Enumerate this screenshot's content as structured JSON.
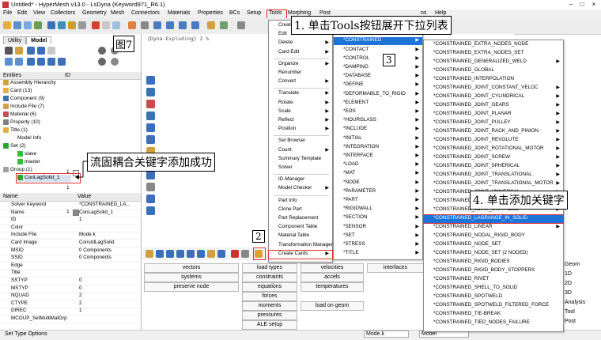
{
  "window": {
    "title": "Untitled* - HyperMesh v13.0 - LsDyna (Keyword971_R6.1)"
  },
  "menubar": [
    "File",
    "Edit",
    "View",
    "Collectors",
    "Geometry",
    "Mesh",
    "Connectors",
    "Materials",
    "Properties",
    "BCs",
    "Setup",
    "Tools",
    "Morphing",
    "Post",
    "ns",
    "Help"
  ],
  "command_line": "{Dyna-Exploding} 2 %",
  "browser": {
    "tabs": [
      "Utility",
      "Model"
    ],
    "columns": [
      "Entities",
      "ID"
    ],
    "tree": [
      {
        "label": "Assembly Hierarchy"
      },
      {
        "label": "Card (13)"
      },
      {
        "label": "Component (9)"
      },
      {
        "label": "Include File (7)"
      },
      {
        "label": "Material (6)"
      },
      {
        "label": "Property (10)"
      },
      {
        "label": "Title (1)"
      },
      {
        "label": "Model Info",
        "id": "1"
      },
      {
        "label": "Set (2)"
      },
      {
        "label": "slave",
        "id": "1"
      },
      {
        "label": "master",
        "id": "2"
      },
      {
        "label": "Group (1)"
      },
      {
        "label": "ConLagSolid_1",
        "id": "1"
      }
    ]
  },
  "properties": {
    "columns": [
      "Name",
      "Value"
    ],
    "rows": [
      {
        "k": "Solver Keyword",
        "v": "*CONSTRAINED_LA..."
      },
      {
        "k": "Name",
        "v": "ConLagSolid_1"
      },
      {
        "k": "ID",
        "v": "1"
      },
      {
        "k": "Color",
        "v": ""
      },
      {
        "k": "Include File",
        "v": "Mode.k"
      },
      {
        "k": "Card Image",
        "v": "ConstdLagSolid"
      },
      {
        "k": "MSID",
        "v": "0 Components"
      },
      {
        "k": "SSID",
        "v": "0 Components"
      },
      {
        "k": "Edge",
        "v": ""
      },
      {
        "k": "Title",
        "v": ""
      },
      {
        "k": "SSTYP",
        "v": "0"
      },
      {
        "k": "MSTYP",
        "v": "0"
      },
      {
        "k": "NQUAD",
        "v": "2"
      },
      {
        "k": "CTYPE",
        "v": "2"
      },
      {
        "k": "DIREC",
        "v": "1"
      },
      {
        "k": "MCOUP_SetMultiMatGrp",
        "v": ""
      }
    ]
  },
  "status": "Set Type Options",
  "tools_menu": [
    "Create",
    "Edit",
    "Delete",
    "Card Edit",
    "Organize",
    "Renumber",
    "Convert",
    "Translate",
    "Rotate",
    "Scale",
    "Reflect",
    "Position",
    "Set Browser",
    "Count",
    "Summary Template",
    "Solver",
    "ID-Manager",
    "Model Checker",
    "Part Info",
    "Clone Part",
    "Part Replacement",
    "Component Table",
    "Material Table",
    "Transformation Manager",
    "Create Cards"
  ],
  "create_cards_menu": [
    "*AIRBAG",
    "*BOUNDARY",
    "*CONSTRAINED",
    "*CONTACT",
    "*CONTROL",
    "*DAMPING",
    "*DATABASE",
    "*DEFINE",
    "*DEFORMABLE_TO_RIGID",
    "*ELEMENT",
    "*EOS",
    "*HOURGLASS",
    "*INCLUDE",
    "*INITIAL",
    "*INTEGRATION",
    "*INTERFACE",
    "*LOAD",
    "*MAT",
    "*NODE",
    "*PARAMETER",
    "*PART",
    "*RIGIDWALL",
    "*SECTION",
    "*SENSOR",
    "*SET",
    "*STRESS",
    "*TITLE"
  ],
  "constrained_menu": [
    "*CONSTRAINED_EXTRA_NODES_NODE",
    "*CONSTRAINED_EXTRA_NODES_SET",
    "*CONSTRAINED_GENERALIZED_WELD",
    "*CONSTRAINED_GLOBAL",
    "*CONSTRAINED_INTERPOLATION",
    "*CONSTRAINED_JOINT_CONSTANT_VELOC",
    "*CONSTRAINED_JOINT_CYLINDRICAL",
    "*CONSTRAINED_JOINT_GEARS",
    "*CONSTRAINED_JOINT_PLANAR",
    "*CONSTRAINED_JOINT_PULLEY",
    "*CONSTRAINED_JOINT_RACK_AND_PINION",
    "*CONSTRAINED_JOINT_REVOLUTE",
    "*CONSTRAINED_JOINT_ROTATIONAL_MOTOR",
    "*CONSTRAINED_JOINT_SCREW",
    "*CONSTRAINED_JOINT_SPHERICAL",
    "*CONSTRAINED_JOINT_TRANSLATIONAL",
    "*CONSTRAINED_JOINT_TRANSLATIONAL_MOTOR",
    "*CONSTRAINED_JOINT_UNIVERSAL",
    "*CONSTRAINED_JOINT_USER_DEFINED",
    "*CONSTRAINED_JOINT_STIFFNESS",
    "*CONSTRAINED_LAGRANGE_IN_SOLID",
    "*CONSTRAINED_LINEAR",
    "*CONSTRAINED_NODAL_RIGID_BODY",
    "*CONSTRAINED_NODE_SET",
    "*CONSTRAINED_NODE_SET (2 NODED)",
    "*CONSTRAINED_RIGID_BODIES",
    "*CONSTRAINED_RIGID_BODY_STOPPERS",
    "*CONSTRAINED_RIVET",
    "*CONSTRAINED_SHELL_TO_SOLID",
    "*CONSTRAINED_SPOTWELD",
    "*CONSTRAINED_SPOTWELD_FILTERED_FORCE",
    "*CONSTRAINED_TIE-BREAK",
    "*CONSTRAINED_TIED_NODES_FAILURE"
  ],
  "panels": {
    "col1": [
      "vectors",
      "systems",
      "preserve node"
    ],
    "col2": [
      "load types",
      "constraints",
      "equations",
      "forces",
      "moments",
      "pressures",
      "ALE setup"
    ],
    "col3": [
      "velocities",
      "accels",
      "temperatures",
      "",
      "load on geom"
    ],
    "col4": [
      "interfaces",
      "",
      "",
      "",
      "",
      "Mode.k"
    ],
    "right": [
      "Geom",
      "1D",
      "2D",
      "3D",
      "Analysis",
      "Tool",
      "Post"
    ],
    "model_label": "Model"
  },
  "annotations": {
    "fig": "图7",
    "step1": "1. 单击Tools按钮展开下拉列表",
    "step2": "2",
    "step3": "3",
    "step4": "4. 单击添加关键字",
    "success": "流固耦合关键字添加成功"
  },
  "colors": {
    "highlight": "#1e73d8",
    "callout_border": "#000000",
    "red_box": "#e03030"
  }
}
